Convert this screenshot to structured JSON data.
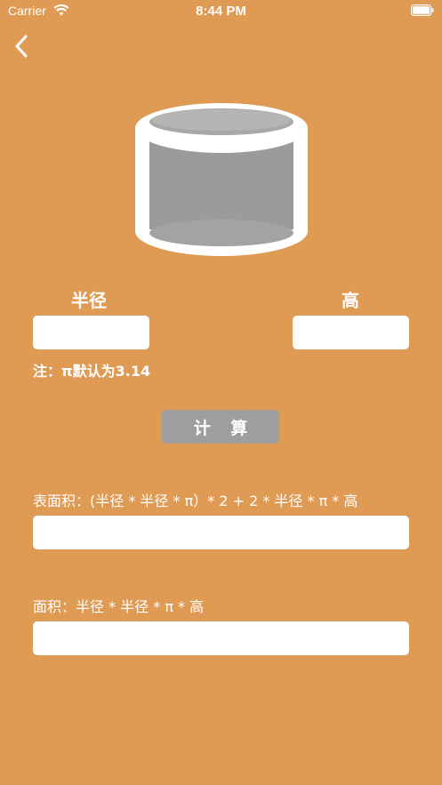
{
  "status_bar": {
    "carrier": "Carrier",
    "time": "8:44 PM"
  },
  "icons": {
    "back": "chevron-left-icon",
    "wifi": "wifi-icon",
    "battery": "battery-icon",
    "shape": "cylinder-icon"
  },
  "labels": {
    "radius": "半径",
    "height": "高"
  },
  "inputs": {
    "radius_value": "",
    "height_value": ""
  },
  "note": "注：π默认为3.14",
  "calculate_button": "计 算",
  "results": {
    "surface_formula": "表面积：(半径 * 半径 * π）* 2 + 2 * 半径 * π * 高",
    "surface_value": "",
    "volume_formula": "面积：半径 * 半径 * π * 高",
    "volume_value": ""
  },
  "colors": {
    "background": "#DF9A53",
    "button": "#9E9E9E",
    "field": "#FFFFFF",
    "text": "#FFFFFF"
  }
}
